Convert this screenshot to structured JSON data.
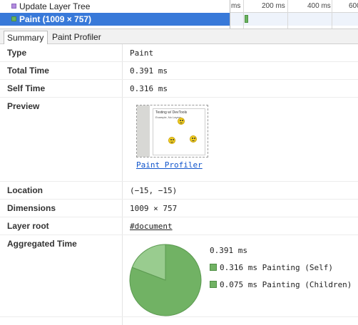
{
  "records": [
    {
      "label": "Update Layer Tree",
      "color": "#b38cde",
      "selected": false
    },
    {
      "label": "Paint (1009 × 757)",
      "color": "#6ab360",
      "selected": true
    }
  ],
  "timeline": {
    "ticks": [
      "ms",
      "200 ms",
      "400 ms",
      "600"
    ]
  },
  "tabs": [
    {
      "label": "Summary",
      "active": true
    },
    {
      "label": "Paint Profiler",
      "active": false
    }
  ],
  "details": {
    "type": {
      "label": "Type",
      "value": "Paint"
    },
    "total_time": {
      "label": "Total Time",
      "value": "0.391 ms"
    },
    "self_time": {
      "label": "Self Time",
      "value": "0.316 ms"
    },
    "preview": {
      "label": "Preview",
      "link": "Paint Profiler",
      "thumb_title": "Testing w/ DevTools",
      "thumb_subtitle": "Example, No Layers"
    },
    "location": {
      "label": "Location",
      "value": "(−15, −15)"
    },
    "dimensions": {
      "label": "Dimensions",
      "value": "1009 × 757"
    },
    "layer_root": {
      "label": "Layer root",
      "value": "#document"
    },
    "aggregated": {
      "label": "Aggregated Time",
      "total": "0.391 ms",
      "items": [
        {
          "label": "0.316 ms Painting (Self)",
          "value": 0.316,
          "color": "#71b264"
        },
        {
          "label": "0.075 ms Painting (Children)",
          "value": 0.075,
          "color": "#99cc8f"
        }
      ]
    }
  }
}
